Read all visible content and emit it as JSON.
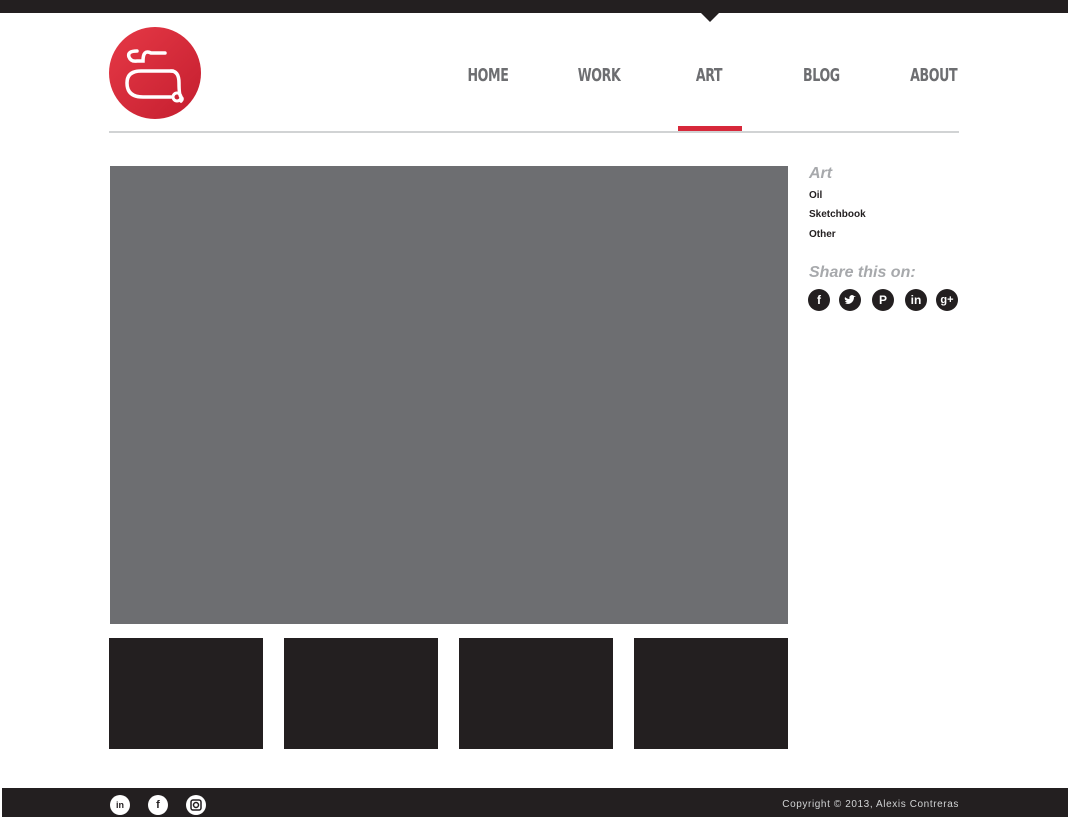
{
  "header": {
    "nav": [
      {
        "label": "HOME",
        "active": false
      },
      {
        "label": "WORK",
        "active": false
      },
      {
        "label": "ART",
        "active": true
      },
      {
        "label": "BLOG",
        "active": false
      },
      {
        "label": "ABOUT",
        "active": false
      }
    ],
    "logo_icon": "ac-monogram-logo"
  },
  "sidebar": {
    "heading": "Art",
    "links": [
      "Oil",
      "Sketchbook",
      "Other"
    ],
    "share_heading": "Share this on:",
    "share_icons": [
      "facebook-icon",
      "twitter-icon",
      "pinterest-icon",
      "linkedin-icon",
      "google-plus-icon"
    ]
  },
  "footer": {
    "social_icons": [
      "linkedin-icon",
      "facebook-icon",
      "instagram-icon"
    ],
    "copyright": "Copyright  © 2013, Alexis Contreras"
  },
  "colors": {
    "accent": "#d7283a",
    "dark": "#231f20",
    "placeholder": "#6d6e71",
    "rule": "#d1d3d4"
  }
}
